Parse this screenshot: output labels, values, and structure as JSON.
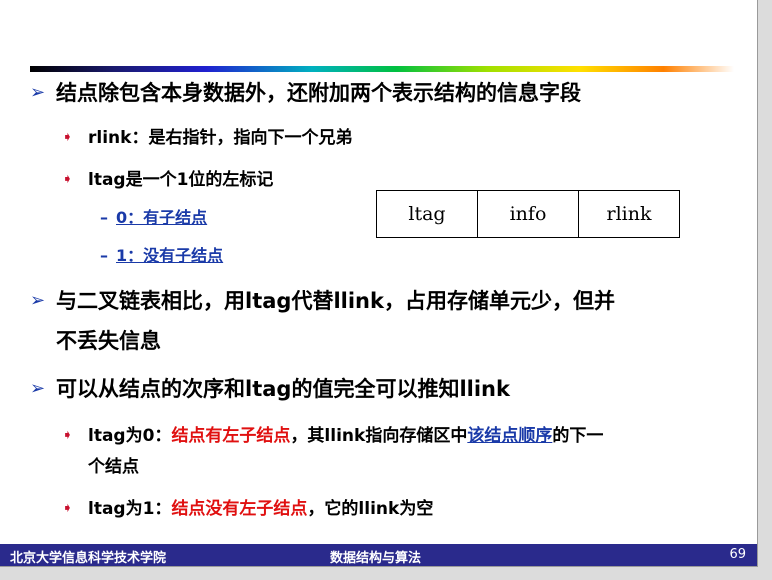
{
  "bullets": {
    "b1": "结点除包含本身数据外，还附加两个表示结构的信息字段",
    "b1_1": "rlink：是右指针，指向下一个兄弟",
    "b1_2": "ltag是一个1位的左标记",
    "b1_2_1": "0：有子结点",
    "b1_2_2": "1：没有子结点",
    "b2_line1": "与二叉链表相比，用ltag代替llink，占用存储单元少，但并",
    "b2_line2": "不丢失信息",
    "b3": "可以从结点的次序和ltag的值完全可以推知llink",
    "b3_1_a": "ltag为0：",
    "b3_1_b": "结点有左子结点",
    "b3_1_c": "，其llink指向存储区中",
    "b3_1_d": "该结点顺序",
    "b3_1_e": "的下一",
    "b3_1_f": "个结点",
    "b3_2_a": "ltag为1：",
    "b3_2_b": "结点没有左子结点",
    "b3_2_c": "，它的llink为空"
  },
  "node_structure": [
    "ltag",
    "info",
    "rlink"
  ],
  "footer": {
    "institution": "北京大学信息科学技术学院",
    "course": "数据结构与算法",
    "page": "69"
  },
  "icons": {
    "level1_bullet": "arrow-outline-icon",
    "level2_bullet": "arrow-solid-icon",
    "level3_bullet": "dash"
  },
  "colors": {
    "accent_blue": "#1a3aa8",
    "emphasis_red": "#e01010",
    "footer_bg": "#2a2a8c"
  }
}
